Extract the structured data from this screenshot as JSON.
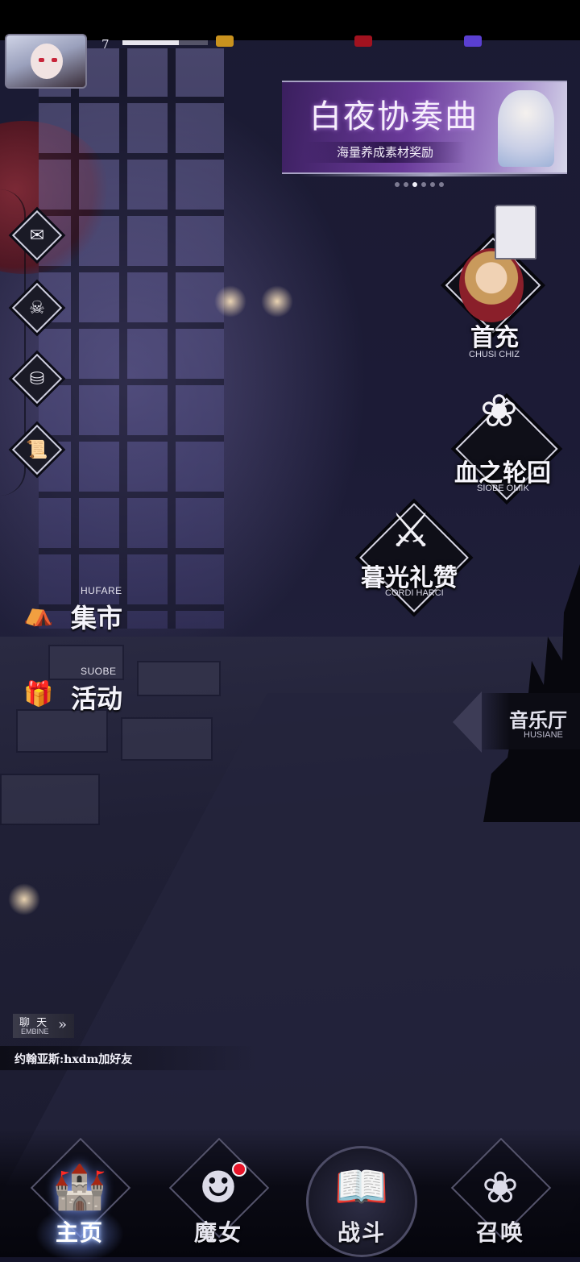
{
  "player": {
    "level": "7",
    "xp_fraction": 0.66
  },
  "banner": {
    "title": "白夜协奏曲",
    "subtitle": "海量养成素材奖励",
    "dots_total": 6,
    "active_dot": 2
  },
  "left_icons": [
    {
      "name": "mail-icon",
      "glyph": "✉"
    },
    {
      "name": "ghost-icon",
      "glyph": "☠"
    },
    {
      "name": "bag-icon",
      "glyph": "⛁"
    },
    {
      "name": "scroll-icon",
      "glyph": "📜"
    }
  ],
  "side_links": [
    {
      "icon": "market-icon",
      "glyph": "⛺",
      "sub": "HUFARE",
      "label": "集市"
    },
    {
      "icon": "event-icon",
      "glyph": "🎁",
      "sub": "SUOBE",
      "label": "活动"
    }
  ],
  "features": {
    "first_charge": {
      "title": "首充",
      "caption": "CHUSI CHIZ"
    },
    "blood_cycle": {
      "title": "血之轮回",
      "caption": "SIOBE OMIK"
    },
    "twilight": {
      "title": "暮光礼赞",
      "caption": "CORDI HARCI"
    },
    "music_hall": {
      "title": "音乐厅",
      "caption": "HUSIANE"
    }
  },
  "chat": {
    "tab_label": "聊 天",
    "tab_sub": "EMBINE",
    "chevron": "»",
    "message": "约翰亚斯:hxdm加好友"
  },
  "nav": [
    {
      "id": "home",
      "label": "主页",
      "glyph": "🏰",
      "active": true,
      "badge": false
    },
    {
      "id": "witch",
      "label": "魔女",
      "glyph": "☻",
      "active": false,
      "badge": true
    },
    {
      "id": "battle",
      "label": "战斗",
      "glyph": "📖",
      "active": false,
      "badge": false
    },
    {
      "id": "summon",
      "label": "召唤",
      "glyph": "❀",
      "active": false,
      "badge": false
    }
  ],
  "colors": {
    "accent_glow": "#7e9dff",
    "badge_red": "#e8152a",
    "banner_purple": "#6a3a9a"
  }
}
